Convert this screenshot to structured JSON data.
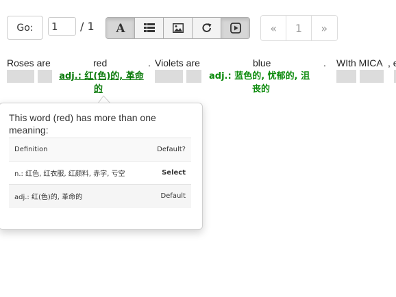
{
  "toolbar": {
    "go_label": "Go:",
    "page_value": "1",
    "page_total": "/ 1",
    "mode_buttons": [
      {
        "icon": "font-icon",
        "active": true
      },
      {
        "icon": "list-icon",
        "active": false
      },
      {
        "icon": "image-icon",
        "active": false
      },
      {
        "icon": "share-icon",
        "active": false
      },
      {
        "icon": "play-square-icon",
        "active": true
      }
    ]
  },
  "pagination": {
    "prev": "«",
    "current": "1",
    "next": "»"
  },
  "reading": {
    "words": [
      "Roses are",
      "red",
      ".",
      "Violets are",
      "blue",
      ".",
      "WIth MICA",
      ", e"
    ],
    "gloss_red_line1": "adj.: 红(色)的, 革命",
    "gloss_red_line2": "的",
    "gloss_blue_line1": "adj.: 蓝色的, 忧郁的, 沮",
    "gloss_blue_line2": "丧的"
  },
  "popover": {
    "title": "This word (red) has more than one meaning:",
    "columns": {
      "definition": "Definition",
      "default": "Default?"
    },
    "rows": [
      {
        "definition": "n.: 红色, 红衣服, 红颜料, 赤字, 亏空",
        "action": "Select"
      },
      {
        "definition": "adj.: 红(色)的, 革命的",
        "action": "Default"
      }
    ]
  },
  "colors": {
    "gloss_green": "#0a8a0a",
    "active_button": "#d6d6d6",
    "placeholder_gray": "#dcdcdc"
  }
}
